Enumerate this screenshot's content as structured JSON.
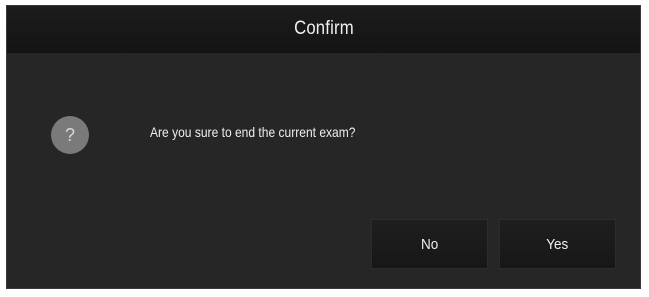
{
  "dialog": {
    "title": "Confirm",
    "icon": "question-icon",
    "icon_glyph": "?",
    "message": "Are you sure to end the current exam?",
    "buttons": {
      "no_label": "No",
      "yes_label": "Yes"
    }
  },
  "colors": {
    "dialog_background": "#262626",
    "titlebar_background": "#161616",
    "icon_background": "#7a7a7a",
    "text": "#f0f0f0"
  }
}
